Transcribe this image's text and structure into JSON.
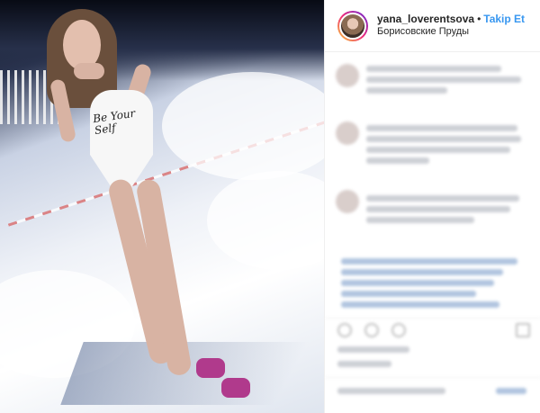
{
  "header": {
    "username": "yana_loverentsova",
    "separator": "•",
    "follow_label": "Takip Et",
    "location": "Борисовские Пруды"
  },
  "photo": {
    "suit_text": "Be Your Self"
  },
  "colors": {
    "follow": "#3897f0",
    "avatar_ring": [
      "#f9ce34",
      "#ee2a7b",
      "#6228d7"
    ]
  },
  "icons": [
    "heart-icon",
    "comment-icon",
    "share-icon",
    "bookmark-icon"
  ]
}
